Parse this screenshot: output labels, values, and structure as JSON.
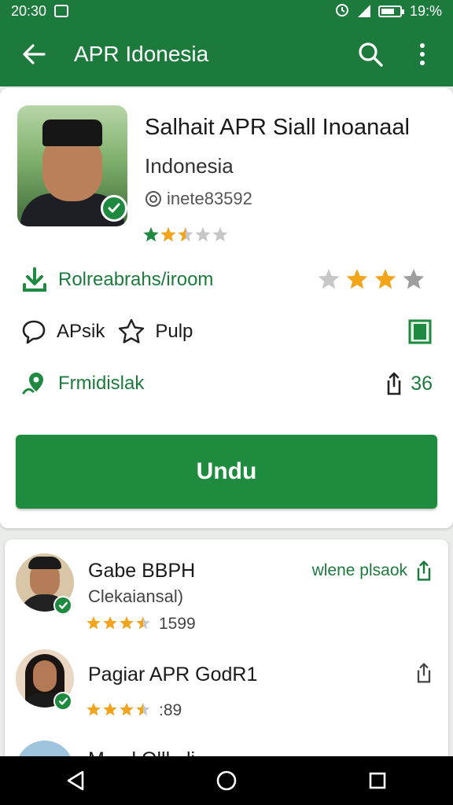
{
  "status_bar": {
    "time": "20:30",
    "battery_text": "19:%"
  },
  "app_bar": {
    "title": "APR Idonesia",
    "back_icon": "arrow-left-icon",
    "search_icon": "search-icon",
    "menu_icon": "more-vert-icon"
  },
  "profile": {
    "name": "Salhait APR Siall Inoanaal",
    "subtitle": "Indonesia",
    "handle": "inete83592",
    "rating": 2.5,
    "rows": {
      "download_label": "Rolreabrahs/iroom",
      "download_rating": 2,
      "comment_label": "APsik",
      "star_label": "Pulp",
      "map_label": "Frmidislak",
      "share_count": "36"
    },
    "primary_button": "Undu"
  },
  "list": [
    {
      "name": "Gabe BBPH",
      "subtitle": "Clekaiansal)",
      "rating": 3.5,
      "rating_text": "1599",
      "action_label": "wlene plsaok"
    },
    {
      "name": "Pagiar APR GodR1",
      "subtitle": "",
      "rating": 3.5,
      "rating_text": ":89",
      "action_label": ""
    },
    {
      "name": "M.... l Olll.. li...",
      "subtitle": "",
      "rating": null,
      "rating_text": "",
      "action_label": ""
    }
  ],
  "colors": {
    "brand_green": "#1d7a3d",
    "button_green": "#1e8b3e",
    "star_green": "#1d8a3f",
    "star_gold": "#f2a51a",
    "star_gray": "#c7c7c7"
  }
}
